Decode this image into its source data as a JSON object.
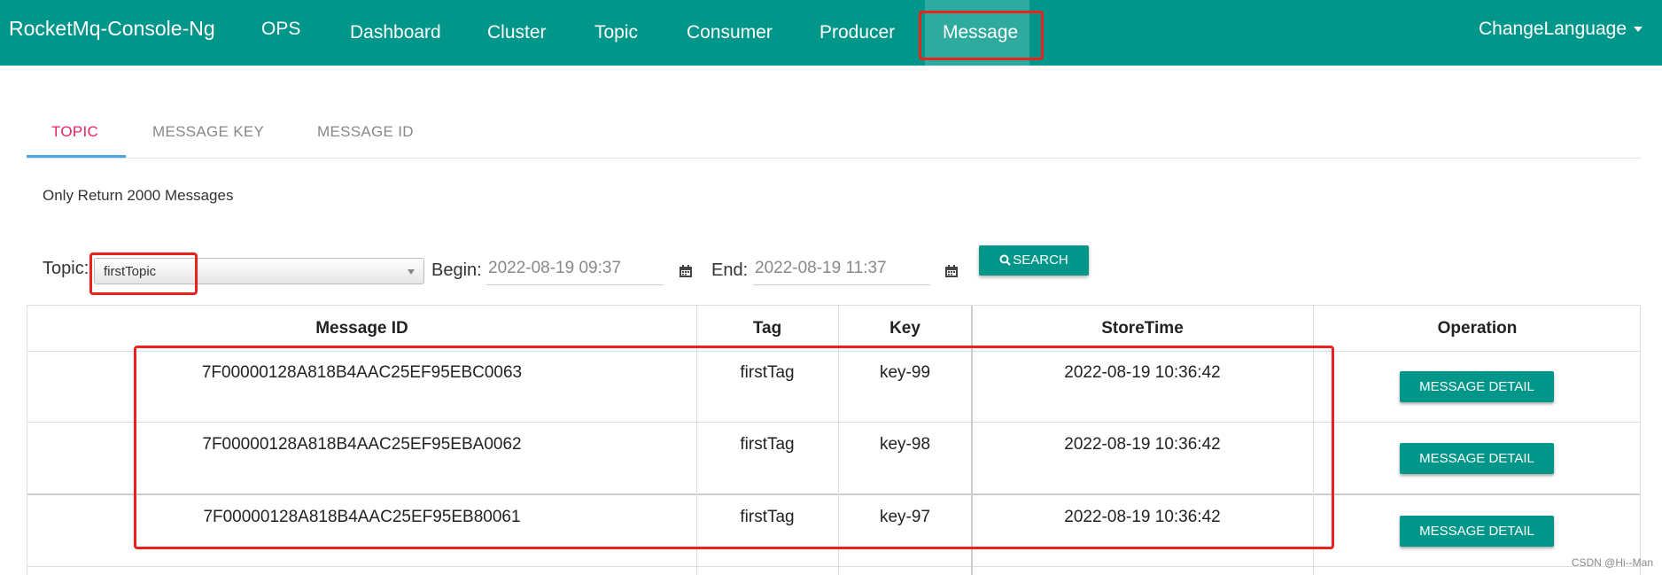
{
  "navbar": {
    "brand": "RocketMq-Console-Ng",
    "items": [
      {
        "label": "OPS"
      },
      {
        "label": "Dashboard"
      },
      {
        "label": "Cluster"
      },
      {
        "label": "Topic"
      },
      {
        "label": "Consumer"
      },
      {
        "label": "Producer"
      },
      {
        "label": "Message",
        "active": true
      }
    ],
    "language_label": "ChangeLanguage",
    "color": "#00968a"
  },
  "tabs": [
    {
      "label": "TOPIC",
      "active": true
    },
    {
      "label": "MESSAGE KEY"
    },
    {
      "label": "MESSAGE ID"
    }
  ],
  "note": "Only Return 2000 Messages",
  "search": {
    "topic_label": "Topic:",
    "topic_value": "firstTopic",
    "begin_label": "Begin:",
    "begin_value": "2022-08-19 09:37",
    "end_label": "End:",
    "end_value": "2022-08-19 11:37",
    "search_button": "SEARCH"
  },
  "table": {
    "headers": [
      "Message ID",
      "Tag",
      "Key",
      "StoreTime",
      "Operation"
    ],
    "rows": [
      {
        "message_id": "7F00000128A818B4AAC25EF95EBC0063",
        "tag": "firstTag",
        "key": "key-99",
        "store_time": "2022-08-19 10:36:42",
        "operation": "MESSAGE DETAIL"
      },
      {
        "message_id": "7F00000128A818B4AAC25EF95EBA0062",
        "tag": "firstTag",
        "key": "key-98",
        "store_time": "2022-08-19 10:36:42",
        "operation": "MESSAGE DETAIL"
      },
      {
        "message_id": "7F00000128A818B4AAC25EF95EB80061",
        "tag": "firstTag",
        "key": "key-97",
        "store_time": "2022-08-19 10:36:42",
        "operation": "MESSAGE DETAIL"
      }
    ]
  },
  "watermark": "CSDN @Hi--Man",
  "colors": {
    "primary": "#00968a",
    "tab_active": "#e8245f",
    "annotation": "#e8231f"
  }
}
